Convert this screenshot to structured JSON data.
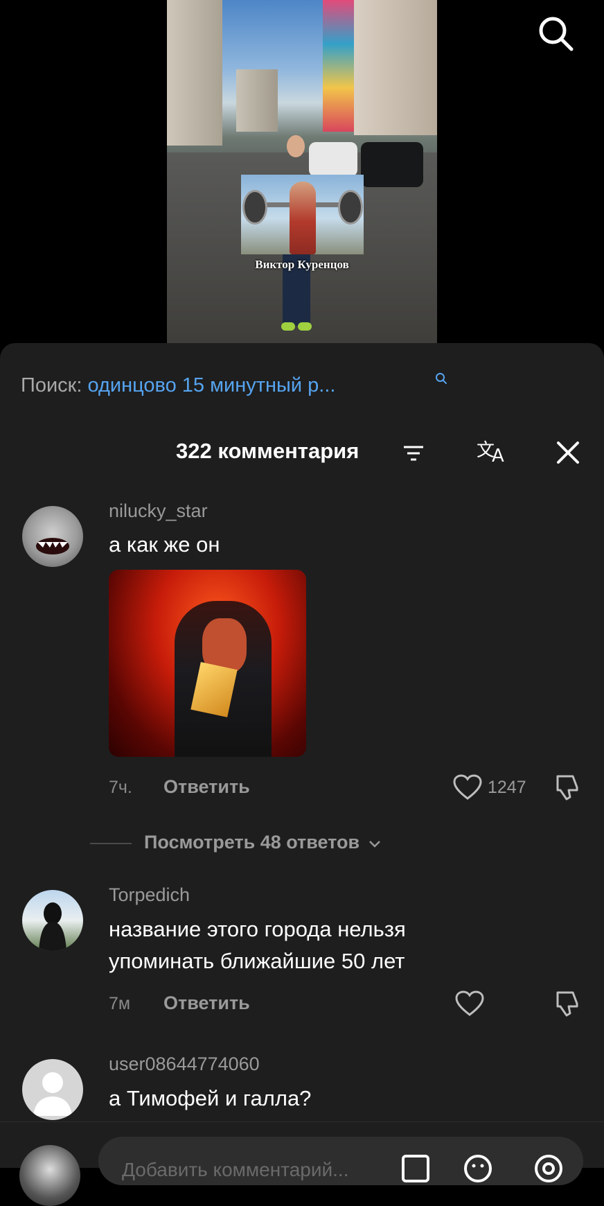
{
  "video": {
    "caption": "Виктор Куренцов"
  },
  "search_bar": {
    "label": "Поиск:",
    "query": "одинцово 15 минутный р..."
  },
  "comments_header": {
    "count_label": "322 комментария"
  },
  "comments": [
    {
      "username": "nilucky_star",
      "text": "а как же он",
      "time": "7ч.",
      "reply_label": "Ответить",
      "likes": "1247"
    },
    {
      "username": "Torpedich",
      "text_lines": [
        "название этого города нельзя",
        "упоминать ближайшие 50 лет"
      ],
      "time": "7м",
      "reply_label": "Ответить",
      "likes": ""
    },
    {
      "username": "user08644774060",
      "text": "а Тимофей и галла?"
    }
  ],
  "view_replies_label": "Посмотреть 48 ответов",
  "input": {
    "placeholder": "Добавить комментарий..."
  },
  "colors": {
    "accent_link": "#56a4f0",
    "sheet_bg": "#1e1e1e"
  }
}
